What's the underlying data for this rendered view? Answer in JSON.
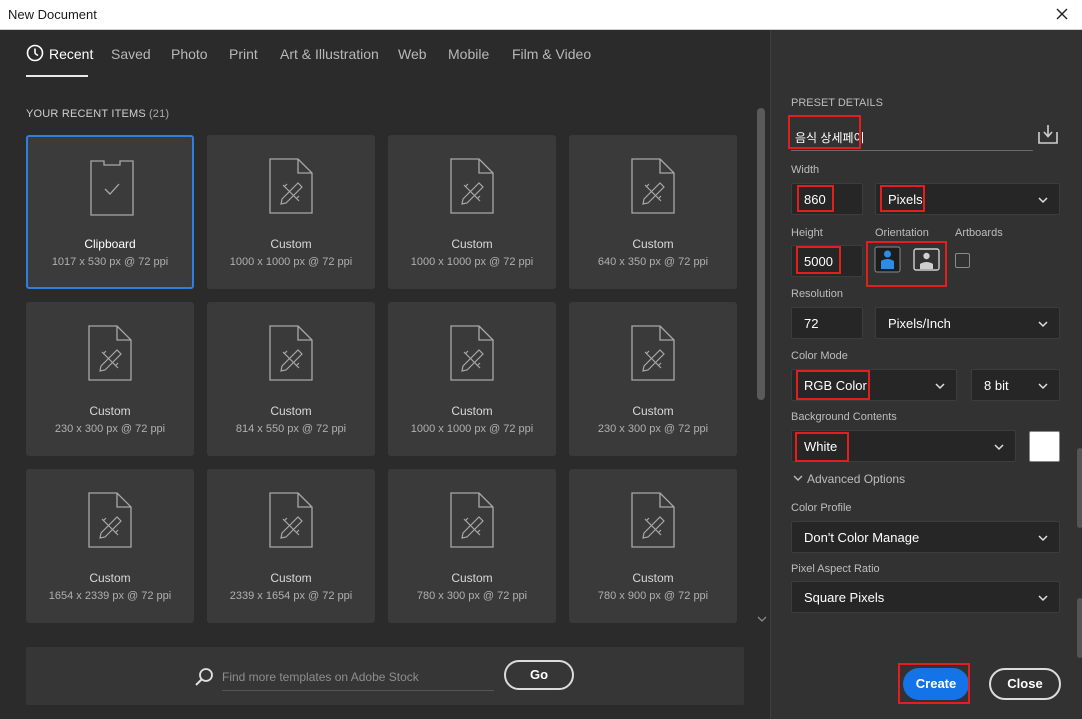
{
  "window": {
    "title": "New Document"
  },
  "tabs": [
    {
      "label": "Recent",
      "active": true
    },
    {
      "label": "Saved"
    },
    {
      "label": "Photo"
    },
    {
      "label": "Print"
    },
    {
      "label": "Art & Illustration"
    },
    {
      "label": "Web"
    },
    {
      "label": "Mobile"
    },
    {
      "label": "Film & Video"
    }
  ],
  "recent": {
    "heading": "YOUR RECENT ITEMS",
    "count": "(21)",
    "items": [
      {
        "name": "Clipboard",
        "meta": "1017 x 530 px @ 72 ppi",
        "selected": true
      },
      {
        "name": "Custom",
        "meta": "1000 x 1000 px @ 72 ppi"
      },
      {
        "name": "Custom",
        "meta": "1000 x 1000 px @ 72 ppi"
      },
      {
        "name": "Custom",
        "meta": "640 x 350 px @ 72 ppi"
      },
      {
        "name": "Custom",
        "meta": "230 x 300 px @ 72 ppi"
      },
      {
        "name": "Custom",
        "meta": "814 x 550 px @ 72 ppi"
      },
      {
        "name": "Custom",
        "meta": "1000 x 1000 px @ 72 ppi"
      },
      {
        "name": "Custom",
        "meta": "230 x 300 px @ 72 ppi"
      },
      {
        "name": "Custom",
        "meta": "1654 x 2339 px @ 72 ppi"
      },
      {
        "name": "Custom",
        "meta": "2339 x 1654 px @ 72 ppi"
      },
      {
        "name": "Custom",
        "meta": "780 x 300 px @ 72 ppi"
      },
      {
        "name": "Custom",
        "meta": "780 x 900 px @ 72 ppi"
      }
    ]
  },
  "search": {
    "placeholder": "Find more templates on Adobe Stock",
    "go_label": "Go"
  },
  "preset": {
    "section_label": "PRESET DETAILS",
    "name": "음식 상세페이",
    "width_label": "Width",
    "width_value": "860",
    "width_unit": "Pixels",
    "height_label": "Height",
    "height_value": "5000",
    "orientation_label": "Orientation",
    "orientation": "portrait",
    "artboards_label": "Artboards",
    "artboards_checked": false,
    "resolution_label": "Resolution",
    "resolution_value": "72",
    "resolution_unit": "Pixels/Inch",
    "color_mode_label": "Color Mode",
    "color_mode": "RGB Color",
    "bit_depth": "8 bit",
    "background_label": "Background Contents",
    "background": "White",
    "background_swatch": "#ffffff",
    "advanced_label": "Advanced Options",
    "color_profile_label": "Color Profile",
    "color_profile": "Don't Color Manage",
    "pixel_aspect_label": "Pixel Aspect Ratio",
    "pixel_aspect": "Square Pixels"
  },
  "actions": {
    "create_label": "Create",
    "close_label": "Close"
  },
  "colors": {
    "accent": "#1473e6",
    "selection": "#2d7fe0",
    "highlight": "#e31e1e",
    "panel": "#323232",
    "background": "#2b2b2b"
  },
  "icons": [
    "clock-icon",
    "close-icon",
    "clipboard-icon",
    "document-icon",
    "search-icon",
    "save-preset-icon",
    "portrait-icon",
    "landscape-icon",
    "chevron-down-icon"
  ]
}
